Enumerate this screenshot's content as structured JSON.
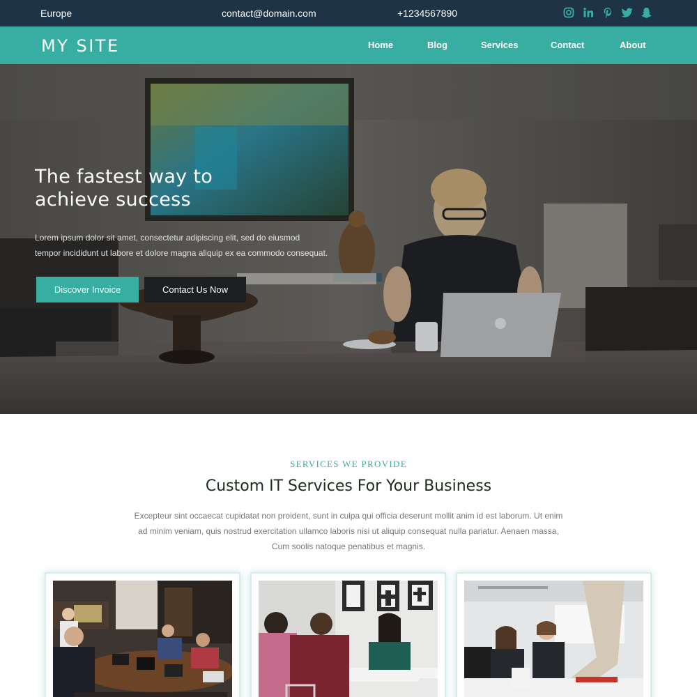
{
  "topbar": {
    "region": "Europe",
    "email": "contact@domain.com",
    "phone": "+1234567890",
    "social_icons": [
      "instagram-icon",
      "linkedin-icon",
      "pinterest-icon",
      "twitter-icon",
      "snapchat-icon"
    ],
    "icon_color": "#38ada1"
  },
  "navbar": {
    "logo": "MY SITE",
    "links": [
      "Home",
      "Blog",
      "Services",
      "Contact",
      "About"
    ],
    "background": "#38ada1"
  },
  "hero": {
    "title_line1": "The fastest way to",
    "title_line2": "achieve success",
    "body_line1": "Lorem ipsum dolor sit amet, consectetur adipiscing elit, sed do eiusmod",
    "body_line2": "tempor incididunt ut labore et dolore magna aliquip ex ea commodo consequat.",
    "primary_button": "Discover Invoice",
    "secondary_button": "Contact Us Now"
  },
  "services": {
    "kicker": "SERVICES WE PROVIDE",
    "title": "Custom IT Services For Your Business",
    "desc_line1": "Excepteur sint occaecat cupidatat non proident, sunt in culpa qui officia deserunt mollit anim id est laborum. Ut enim",
    "desc_line2": "ad minim veniam, quis nostrud exercitation ullamco laboris nisi ut aliquip consequat nulla pariatur. Aenaen massa,",
    "desc_line3": "Cum soolis natoque penatibus et magnis.",
    "cards": [
      "meeting-room-photo",
      "team-discussion-photo",
      "office-workers-photo"
    ]
  },
  "colors": {
    "accent": "#38ada1",
    "topbar": "#1f3347",
    "dark_button": "#1c1f22"
  }
}
